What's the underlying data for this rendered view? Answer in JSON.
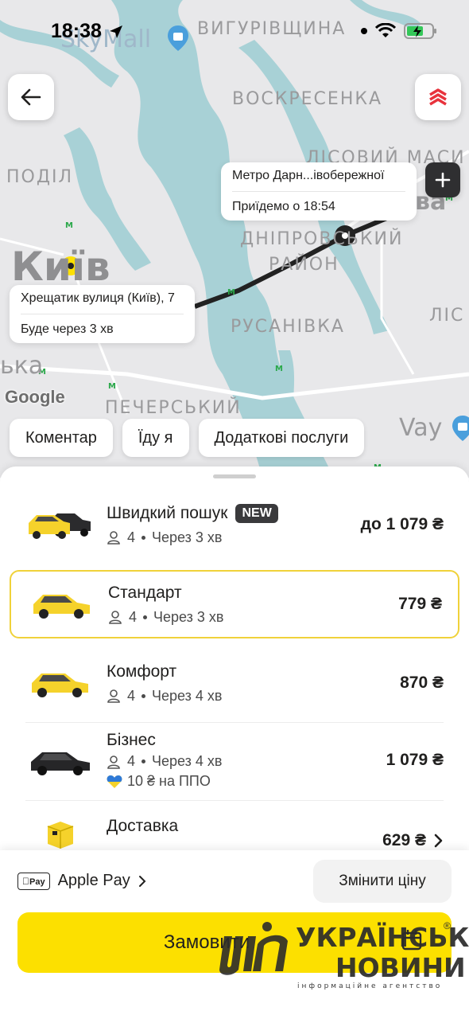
{
  "status_bar": {
    "time": "18:38"
  },
  "map": {
    "labels": {
      "skymall": "SkyMall",
      "vyhurivshchyna": "ВИГУРІВЩИНА",
      "voskresenka": "ВОСКРЕСЕНКА",
      "lisovyi_masyv": "ЛІСОВИЙ МАСИ",
      "podil": "ПОДІЛ",
      "kyiv": "Київ",
      "dniprovskyi": "ДНІПРОВСЬКИЙ",
      "raion": "РАЙОН",
      "rusanivka": "РУСАНІВКА",
      "lis": "ЛІС",
      "pecherskyi": "ПЕЧЕРСЬКИЙ",
      "ka": "ька",
      "va": "ва",
      "vay": "Vay",
      "google": "Google"
    },
    "destination": {
      "name": "Метро Дарн...івобережної",
      "eta": "Приїдемо о 18:54"
    },
    "pickup": {
      "address": "Хрещатик вулиця (Київ), 7",
      "eta": "Буде через 3 хв"
    }
  },
  "chips": [
    "Коментар",
    "Їду я",
    "Додаткові послуги"
  ],
  "tariffs": [
    {
      "name": "Швидкий пошук",
      "badge": "NEW",
      "seats": "4",
      "wait": "Через 3 хв",
      "price": "до 1 079 ₴"
    },
    {
      "name": "Стандарт",
      "seats": "4",
      "wait": "Через 3 хв",
      "price": "779 ₴"
    },
    {
      "name": "Комфорт",
      "seats": "4",
      "wait": "Через 4 хв",
      "price": "870 ₴"
    },
    {
      "name": "Бізнес",
      "seats": "4",
      "wait": "Через 4 хв",
      "promo": "10 ₴ на ППО",
      "price": "1 079 ₴"
    },
    {
      "name": "Доставка",
      "price": "629 ₴"
    }
  ],
  "payment": {
    "badge": "Pay",
    "label": "Apple Pay"
  },
  "change_price": "Змінити ціну",
  "order": "Замовити",
  "watermark": {
    "line1": "УКРАЇНСЬКІ",
    "line2": "НОВИНИ",
    "line3": "інформаційне агентство",
    "mark": "®"
  },
  "colors": {
    "accent": "#fce000",
    "selected_border": "#f0d23a",
    "water": "#a8d1d6",
    "route": "#222222"
  }
}
